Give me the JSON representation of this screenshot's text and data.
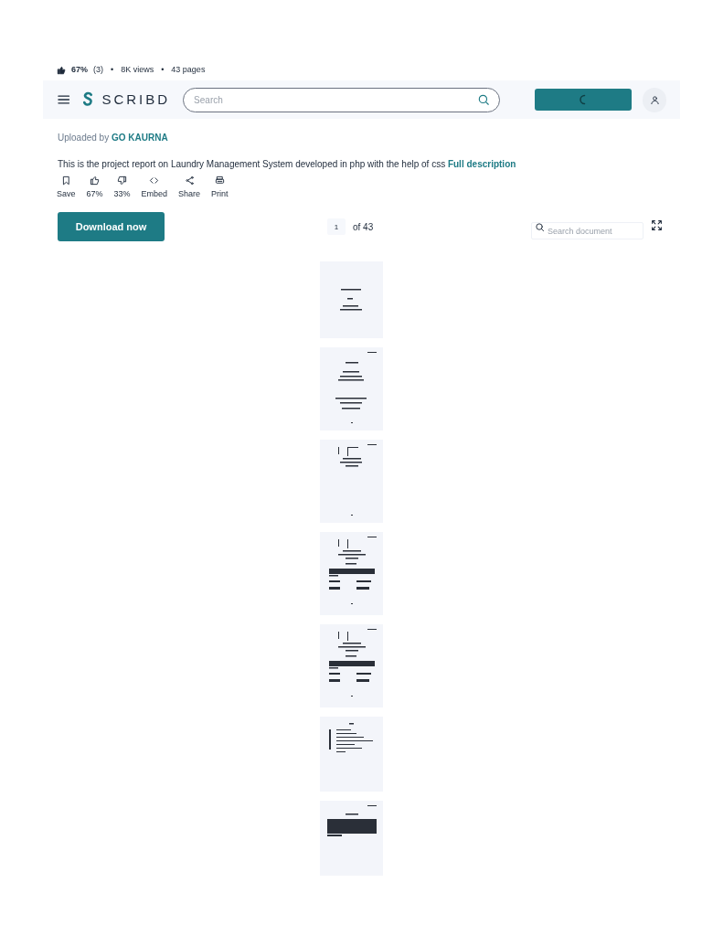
{
  "meta": {
    "rating": "67%",
    "rating_count": "(3)",
    "views": "8K views",
    "pages": "43 pages",
    "separator": "•"
  },
  "header": {
    "logo": "SCRIBD",
    "search": {
      "placeholder": "Search"
    }
  },
  "uploaded": {
    "label": "Uploaded by",
    "author": "GO KAURNA"
  },
  "description": {
    "text": "This is the project report on Laundry Management System developed in php with the help of css",
    "link": "Full description"
  },
  "actions": [
    {
      "kind": "save",
      "label": "Save"
    },
    {
      "kind": "like",
      "label": "67%"
    },
    {
      "kind": "dislike",
      "label": "33%"
    },
    {
      "kind": "embed",
      "label": "Embed"
    },
    {
      "kind": "share",
      "label": "Share"
    },
    {
      "kind": "print",
      "label": "Print"
    }
  ],
  "download": "Download now",
  "pager": {
    "page": "1",
    "of": "of 43"
  },
  "doc_search": {
    "placeholder": "Search document"
  },
  "thumbnails": [
    {
      "kind": "title"
    },
    {
      "kind": "cover"
    },
    {
      "kind": "letter_short"
    },
    {
      "kind": "letter"
    },
    {
      "kind": "letter"
    },
    {
      "kind": "contents"
    },
    {
      "kind": "text"
    }
  ]
}
